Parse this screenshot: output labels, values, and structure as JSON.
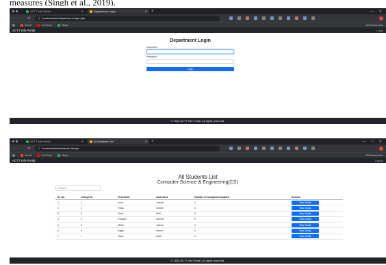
{
  "caption": "measures (Singh et al., 2019).",
  "browser": {
    "window_controls": [
      "—",
      "□",
      "✕"
    ],
    "window_controls_short": [
      "—",
      "✕"
    ],
    "nav": [
      "←",
      "→",
      "⟳"
    ],
    "new_tab": "+"
  },
  "shot1": {
    "tabs": [
      "ACTT Info Portal",
      "Department Login"
    ],
    "address": "localhost/actt/department-login.php",
    "bookmarks": [
      "Gmail",
      "YouTube",
      "Maps"
    ],
    "bookmarks_right": "All Bookmarks",
    "navbar": {
      "brand": "ACTT Info Portal",
      "right": "Login"
    },
    "login": {
      "title": "Department Login",
      "username_label": "Username",
      "password_label": "Password",
      "button": "Login"
    },
    "footer": "© 2024 ACTT Info Portal. All rights reserved."
  },
  "shot2": {
    "tabs": [
      "ACTT Info Portal",
      "All Students List"
    ],
    "address": "localhost/actt/students-list.php",
    "bookmarks": [
      "Gmail",
      "YouTube",
      "Maps"
    ],
    "bookmarks_right": "All Bookmarks",
    "navbar": {
      "brand": "ACTT Info Portal",
      "right": "Logout"
    },
    "title": "All Students List",
    "subtitle": "Computer Science & Engineering(CS)",
    "search_placeholder": "Search...",
    "table": {
      "headers": [
        "Sr. No.",
        "College ID",
        "First Name",
        "Last Name",
        "Number of Companies Applied",
        "Actions"
      ],
      "rows": [
        [
          "1",
          "1",
          "Amar",
          "Jadhav",
          "2",
          "View Details"
        ],
        [
          "2",
          "2",
          "Pratik",
          "Shinde",
          "5",
          "View Details"
        ],
        [
          "3",
          "3",
          "Rohit",
          "Patil",
          "3",
          "View Details"
        ],
        [
          "4",
          "4",
          "Prakash",
          "Kamble",
          "0",
          "View Details"
        ],
        [
          "5",
          "5",
          "Nikhil",
          "Jadhav",
          "0",
          "View Details"
        ],
        [
          "6",
          "6",
          "Sagar",
          "Pawar",
          "0",
          "View Details"
        ],
        [
          "7",
          "7",
          "Vikas",
          "More",
          "0",
          "View Details"
        ]
      ]
    },
    "footer": "© 2024 ACTT Info Portal. All rights reserved."
  },
  "colors": {
    "primary": "#0d6efd",
    "navbar": "#212529",
    "chrome": "#35363a"
  }
}
